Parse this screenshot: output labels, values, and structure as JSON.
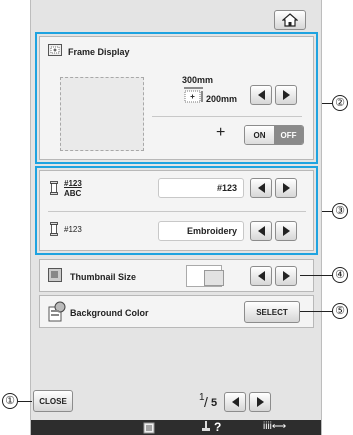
{
  "frame_display": {
    "title": "Frame Display",
    "width_value": "300mm",
    "height_value": "200mm",
    "plus": "+",
    "on_label": "ON",
    "off_label": "OFF"
  },
  "thread": {
    "row1_icon_top": "#123",
    "row1_icon_bottom": "ABC",
    "row1_value": "#123",
    "row2_icon_label": "#123",
    "row2_value": "Embroidery"
  },
  "thumbnail": {
    "label": "Thumbnail Size"
  },
  "background": {
    "label": "Background Color",
    "select_label": "SELECT"
  },
  "footer": {
    "close_label": "CLOSE",
    "page_current": "1",
    "page_total": "5",
    "page_slash": "/"
  },
  "bottombar": {
    "help_label": "?",
    "thread_label": "iiii⟷"
  },
  "callouts": [
    "②",
    "③",
    "④",
    "⑤",
    "①"
  ]
}
